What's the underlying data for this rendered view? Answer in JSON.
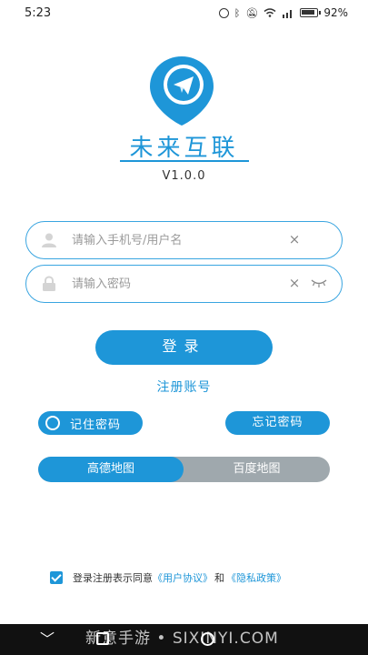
{
  "status_bar": {
    "time": "5:23",
    "battery": "92%",
    "icons": [
      "alarm-icon",
      "bluetooth-icon",
      "mute-icon",
      "wifi-icon",
      "signal-icon",
      "battery-icon"
    ]
  },
  "app": {
    "title": "未来互联",
    "version": "V1.0.0",
    "brand_color": "#1e96d8"
  },
  "form": {
    "username_placeholder": "请输入手机号/用户名",
    "username_value": "",
    "password_placeholder": "请输入密码",
    "password_value": "",
    "clear_glyph": "×"
  },
  "actions": {
    "login_label": "登录",
    "register_label": "注册账号",
    "remember_label": "记住密码",
    "forgot_label": "忘记密码"
  },
  "map_toggle": {
    "options": [
      "高德地图",
      "百度地图"
    ],
    "selected": "高德地图",
    "inactive_color": "#9fa8ad"
  },
  "agreement": {
    "checked": true,
    "prefix": "登录注册表示同意",
    "user_agreement": "《用户协议》",
    "conjunction": "和",
    "privacy_policy": "《隐私政策》"
  },
  "nav": {
    "back_glyph": "﹀",
    "watermark": "新意手游 • SIXINYI.COM"
  }
}
